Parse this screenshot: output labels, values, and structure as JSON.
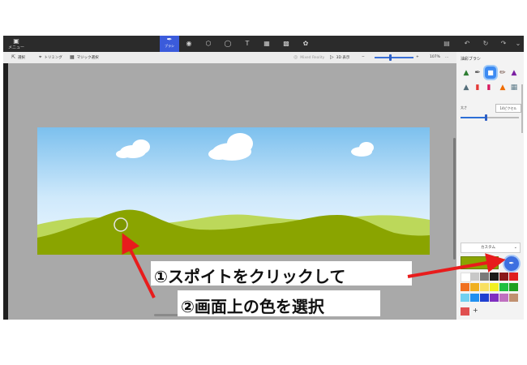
{
  "topbar": {
    "menu_label": "メニュー",
    "active_tool_label": "ブラシ",
    "tools": [
      "brush-icon",
      "sticker-icon",
      "3d-shape-icon",
      "effects-icon",
      "text-icon",
      "canvas-icon",
      "3d-library-icon"
    ],
    "right_tools": [
      "paste-icon",
      "undo-icon",
      "history-icon",
      "redo-icon",
      "expand-icon"
    ]
  },
  "subbar": {
    "select": "選択",
    "crop": "トリミング",
    "magic_select": "マジック選択",
    "mixed_reality": "Mixed Reality",
    "view_3d": "3D 表示",
    "zoom": "107%",
    "more": "..."
  },
  "panel": {
    "title": "油彩ブラシ",
    "size_label": "太さ",
    "size_value": "14ピクセル",
    "custom_label": "カスタム",
    "current_color": "#8aa400"
  },
  "palette": [
    "#ffffff",
    "#c8c8c8",
    "#7a7a7a",
    "#1a1a1a",
    "#8b1a1a",
    "#e02020",
    "#f07020",
    "#f0b020",
    "#f8e060",
    "#f0f020",
    "#20c040",
    "#20a020",
    "#70d0f0",
    "#2090f0",
    "#2040d0",
    "#8030c0",
    "#c070c0",
    "#c09070"
  ],
  "annotations": {
    "line1": "①スポイトをクリックして",
    "line2": "②画面上の色を選択"
  },
  "colors": {
    "accent": "#3b5bdb",
    "arrow": "#e81c1c",
    "sky_top": "#7cc0ee",
    "grass_dark": "#8aa400",
    "grass_light": "#bcd85a"
  }
}
